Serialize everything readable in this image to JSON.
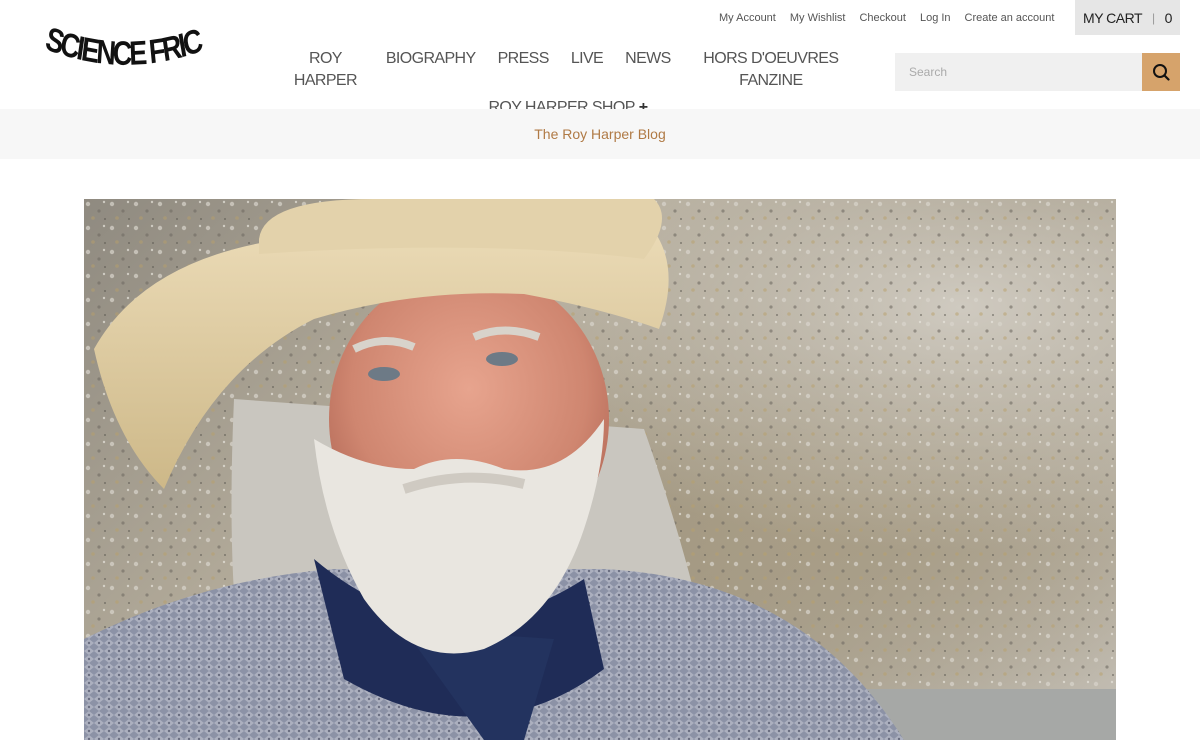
{
  "account": {
    "links": [
      "My Account",
      "My Wishlist",
      "Checkout",
      "Log In",
      "Create an account"
    ]
  },
  "cart": {
    "label": "MY CART",
    "count": "0"
  },
  "logo": {
    "text": "SCIENCE FRICTION"
  },
  "nav": {
    "items": [
      "ROY HARPER",
      "BIOGRAPHY",
      "PRESS",
      "LIVE",
      "NEWS",
      "HORS D'OEUVRES FANZINE"
    ],
    "shop": "ROY HARPER SHOP",
    "shop_toggle": "+"
  },
  "search": {
    "placeholder": "Search",
    "value": ""
  },
  "breadcrumb": {
    "title": "The Roy Harper Blog"
  },
  "colors": {
    "accent": "#d6a36b",
    "link": "#b07a45",
    "band": "#f7f7f7",
    "cart_bg": "#e6e6e6"
  },
  "icons": {
    "search": "search-icon"
  }
}
